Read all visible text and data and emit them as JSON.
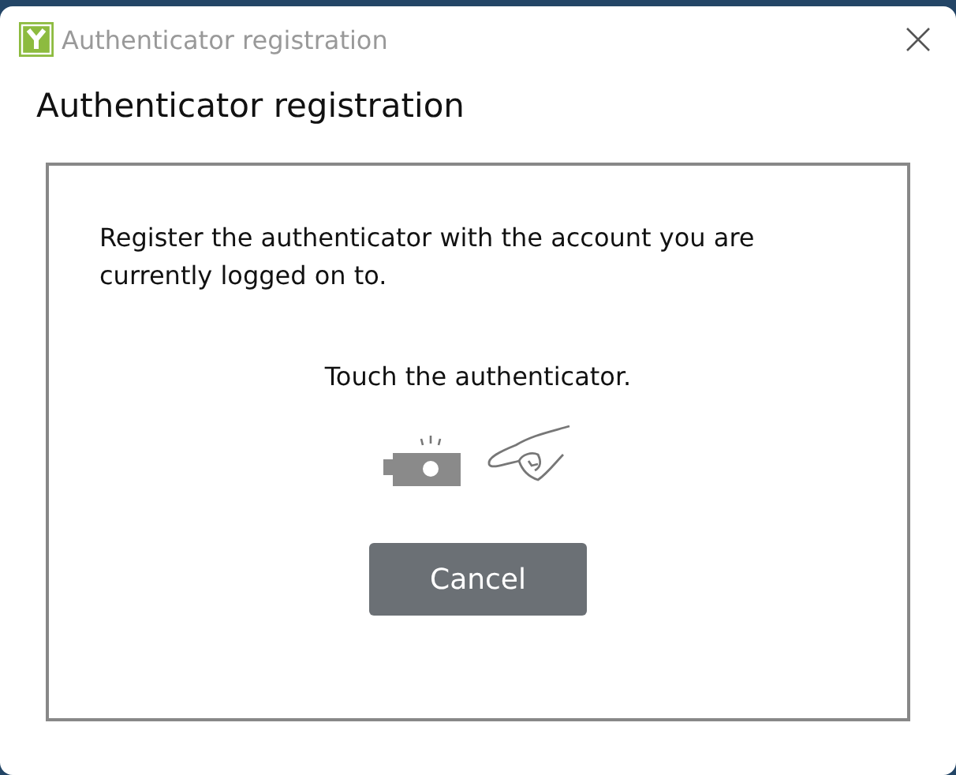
{
  "window": {
    "title": "Authenticator registration"
  },
  "heading": "Authenticator registration",
  "instruction": "Register the authenticator with the account you are currently logged on to.",
  "prompt": "Touch the authenticator.",
  "buttons": [
    "Cancel"
  ]
}
